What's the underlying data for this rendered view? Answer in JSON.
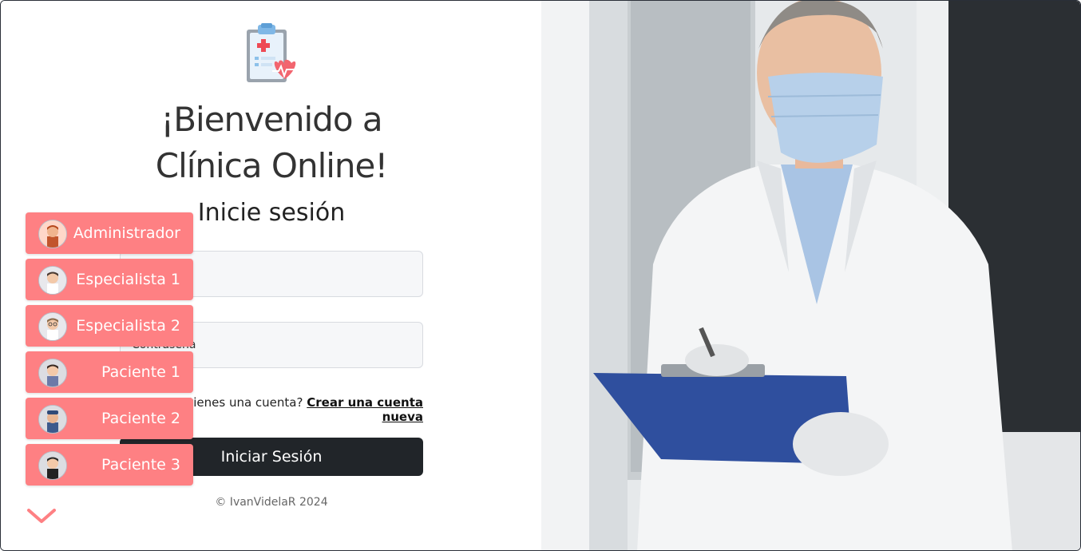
{
  "welcome": {
    "line1": "¡Bienvenido a",
    "line2": "Clínica Online!"
  },
  "login": {
    "heading": "Inicie sesión",
    "email_placeholder": "",
    "password_label": "Contraseña",
    "signup_prompt": "¿No tienes una cuenta?",
    "signup_link": "Crear una cuenta nueva",
    "submit_label": "Iniciar Sesión"
  },
  "quick_access": [
    {
      "label": "Administrador",
      "icon": "admin-avatar-icon"
    },
    {
      "label": "Especialista 1",
      "icon": "specialist-avatar-icon"
    },
    {
      "label": "Especialista 2",
      "icon": "specialist-avatar-icon"
    },
    {
      "label": "Paciente 1",
      "icon": "patient-avatar-icon"
    },
    {
      "label": "Paciente 2",
      "icon": "patient-avatar-icon"
    },
    {
      "label": "Paciente 3",
      "icon": "patient-avatar-icon"
    }
  ],
  "footer": {
    "text": "© IvanVidelaR 2024"
  },
  "colors": {
    "accent": "#fe8083",
    "primary_button": "#212529",
    "field_bg": "#f6f7f9"
  }
}
